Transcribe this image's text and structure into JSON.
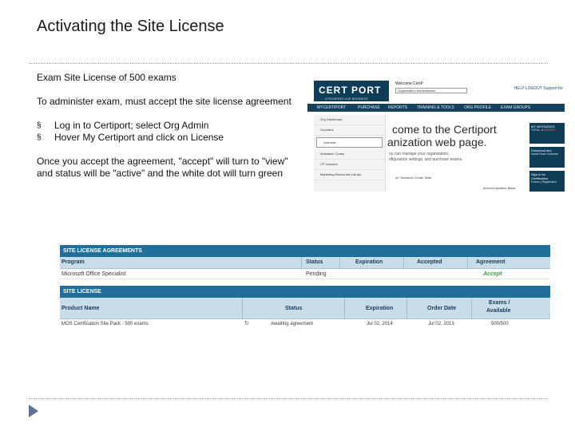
{
  "slide": {
    "title": "Activating the Site License",
    "intro": "Exam Site License of 500 exams",
    "admin_text": "To administer exam, must accept the site license agreement",
    "bullet_glyph": "§",
    "bullets": [
      "Log in to Certiport; select Org Admin",
      "Hover My Certiport and click on License"
    ],
    "note": "Once you accept the agreement, \"accept\" will turn to \"view\" and status will be \"active\" and the white dot will turn green"
  },
  "certiport": {
    "logo": "CERT PORT",
    "logo_tag": "A PEARSON VUE BUSINESS",
    "welcome": "Welcome CertP",
    "role_field": "Organization Administrator",
    "top_links": "HELP  LOGOUT  Support for",
    "nav": [
      "MYCERTIPORT",
      "PURCHASE",
      "REPORTS",
      "TRAINING & TOOLS",
      "ORG PROFILE",
      "EXAM GROUPS"
    ],
    "sidebar": [
      "Org Dashboard",
      "Vouchers",
      "Licenses",
      "Activation Codes",
      "CP Lessons",
      "Marketing Resources Library"
    ],
    "hero_line1": "come to the Certiport",
    "hero_line2": "anization web page.",
    "hero_line3": "ou can manage your organization,",
    "hero_line4": "nfiguration settings, and purchase exams.",
    "contact": "ort Technical Center    Start",
    "footnote": "Account expiration: Below",
    "right_boxes": [
      {
        "title": "MY MESSAGES",
        "sub": "TOTAL: 0",
        "alert": "URGENT"
      },
      {
        "title": "Download and",
        "sub": "Install Exam Software"
      },
      {
        "title": "Sign in for Certification",
        "sub": "Exams | Registration"
      }
    ]
  },
  "site_license_agreements": {
    "title": "SITE LICENSE AGREEMENTS",
    "headers": [
      "Program",
      "Status",
      "Expiration",
      "Accepted",
      "Agreement"
    ],
    "row": [
      "Microsoft Office Specialist",
      "Pending",
      "",
      "",
      "Accept"
    ]
  },
  "site_license": {
    "title": "SITE LICENSE",
    "headers": [
      "Product Name",
      "Status",
      "Expiration",
      "Order Date",
      "Exams /",
      "Available"
    ],
    "row": [
      "MOS Certification Site Pack - 500 exams",
      "Awaiting agreement",
      "Jul 02, 2014",
      "Jul 02, 2013",
      "500/500"
    ],
    "status_icon": "↻"
  }
}
